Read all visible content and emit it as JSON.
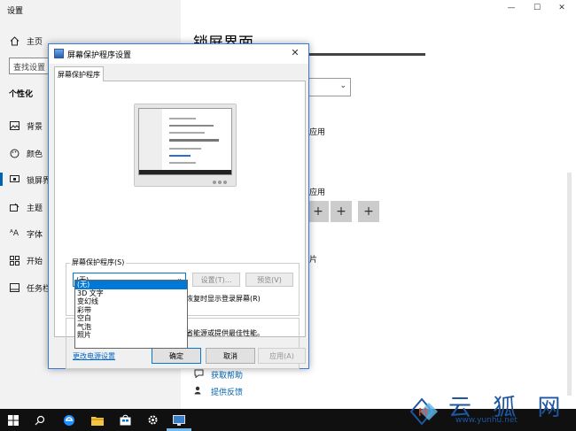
{
  "settings": {
    "title": "设置",
    "window_controls": [
      "—",
      "☐",
      "✕"
    ],
    "sidebar": {
      "home": "主页",
      "search_placeholder": "查找设置",
      "section": "个性化",
      "items": [
        {
          "label": "背景",
          "icon": "picture-icon"
        },
        {
          "label": "颜色",
          "icon": "palette-icon"
        },
        {
          "label": "锁屏界",
          "icon": "lock-screen-icon"
        },
        {
          "label": "主题",
          "icon": "theme-icon"
        },
        {
          "label": "字体",
          "icon": "font-icon"
        },
        {
          "label": "开始",
          "icon": "start-icon"
        },
        {
          "label": "任务栏",
          "icon": "taskbar-icon"
        }
      ]
    },
    "main": {
      "title": "锁屏界面",
      "fragments": {
        "f1": "应用",
        "f2": "应用",
        "f3": "片"
      },
      "plus": "+",
      "links": {
        "help": "获取帮助",
        "feedback": "提供反馈"
      }
    }
  },
  "dialog": {
    "title": "屏幕保护程序设置",
    "close": "✕",
    "tab": "屏幕保护程序",
    "group_label": "屏幕保护程序(S)",
    "selected": "(无)",
    "settings_btn": "设置(T)...",
    "preview_btn": "预览(V)",
    "wait_text": "恢复时显示登录屏幕(R)",
    "power_text": "省能源或提供最佳性能。",
    "power_link": "更改电源设置",
    "options": [
      "(无)",
      "3D 文字",
      "变幻线",
      "彩带",
      "空白",
      "气泡",
      "照片"
    ],
    "ok": "确定",
    "cancel": "取消",
    "apply": "应用(A)"
  },
  "watermark": {
    "text": "云 狐 网",
    "url": "www.yunhu.net"
  }
}
